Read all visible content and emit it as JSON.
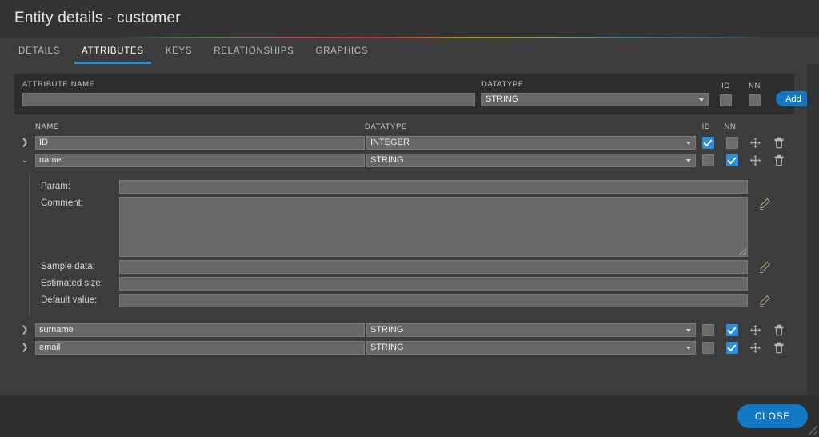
{
  "window": {
    "title": "Entity details - customer"
  },
  "tabs": [
    {
      "label": "DETAILS",
      "active": false
    },
    {
      "label": "ATTRIBUTES",
      "active": true
    },
    {
      "label": "KEYS",
      "active": false
    },
    {
      "label": "RELATIONSHIPS",
      "active": false
    },
    {
      "label": "GRAPHICS",
      "active": false
    }
  ],
  "add_panel": {
    "name_label": "ATTRIBUTE NAME",
    "name_value": "",
    "datatype_label": "DATATYPE",
    "datatype_value": "STRING",
    "id_label": "ID",
    "nn_label": "NN",
    "id_checked": false,
    "nn_checked": false,
    "add_label": "Add"
  },
  "table": {
    "headers": {
      "name": "NAME",
      "datatype": "DATATYPE",
      "id": "ID",
      "nn": "NN"
    },
    "rows": [
      {
        "name": "ID",
        "datatype": "INTEGER",
        "id": true,
        "nn": false,
        "expanded": false
      },
      {
        "name": "name",
        "datatype": "STRING",
        "id": false,
        "nn": true,
        "expanded": true
      },
      {
        "name": "surname",
        "datatype": "STRING",
        "id": false,
        "nn": true,
        "expanded": false
      },
      {
        "name": "email",
        "datatype": "STRING",
        "id": false,
        "nn": true,
        "expanded": false
      }
    ]
  },
  "detail": {
    "param_label": "Param:",
    "param_value": "",
    "comment_label": "Comment:",
    "comment_value": "",
    "sample_label": "Sample data:",
    "sample_value": "",
    "estimated_label": "Estimated size:",
    "estimated_value": "",
    "default_label": "Default value:",
    "default_value": ""
  },
  "footer": {
    "close_label": "CLOSE"
  },
  "colors": {
    "accent": "#2b8fd8",
    "button": "#1277c4",
    "dialog_bg": "#3c3c3c",
    "titlebar_bg": "#333333",
    "field_bg": "#676767"
  }
}
